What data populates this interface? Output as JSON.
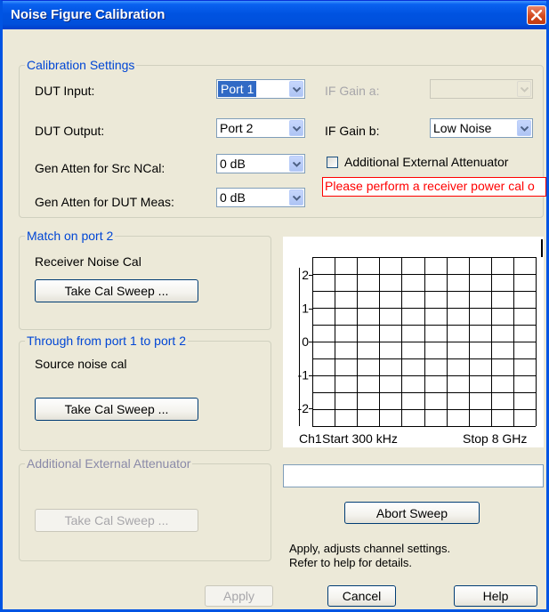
{
  "window": {
    "title": "Noise Figure Calibration"
  },
  "calibration_settings": {
    "legend": "Calibration Settings",
    "dut_input": {
      "label": "DUT Input:",
      "value": "Port 1"
    },
    "dut_output": {
      "label": "DUT Output:",
      "value": "Port 2"
    },
    "gen_atten_src": {
      "label": "Gen Atten for Src NCal:",
      "value": "0 dB"
    },
    "gen_atten_dut": {
      "label": "Gen Atten for DUT Meas:",
      "value": "0 dB"
    },
    "if_gain_a": {
      "label": "IF Gain a:",
      "value": ""
    },
    "if_gain_b": {
      "label": "IF Gain b:",
      "value": "Low Noise"
    },
    "additional_attenuator": {
      "label": "Additional External Attenuator",
      "checked": false
    },
    "warning": "Please perform a receiver power cal o"
  },
  "match_group": {
    "legend": "Match on port 2",
    "description": "Receiver Noise Cal",
    "button": "Take Cal Sweep ..."
  },
  "through_group": {
    "legend": "Through from port 1 to port 2",
    "description": "Source noise cal",
    "button": "Take Cal Sweep ..."
  },
  "attenuator_group": {
    "legend": "Additional External Attenuator",
    "button": "Take Cal Sweep ..."
  },
  "plot": {
    "y_ticks": [
      "2",
      "1",
      "0",
      "-1",
      "-2"
    ],
    "footer_channel": "Ch1",
    "footer_start": "Start 300 kHz",
    "footer_stop": "Stop 8 GHz"
  },
  "abort_button": "Abort Sweep",
  "info": {
    "line1": "Apply, adjusts channel settings.",
    "line2": "Refer to help for details."
  },
  "footer": {
    "apply": "Apply",
    "cancel": "Cancel",
    "help": "Help"
  }
}
